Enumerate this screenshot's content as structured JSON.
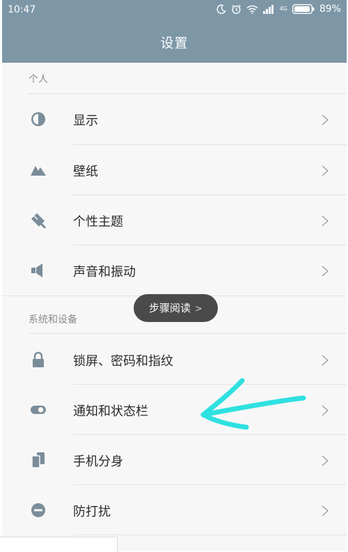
{
  "status_bar": {
    "time": "10:47",
    "battery": "89%",
    "network_small": "4G"
  },
  "header": {
    "title": "设置"
  },
  "sections": [
    {
      "label": "个人",
      "items": [
        {
          "label": "显示",
          "icon": "display-icon"
        },
        {
          "label": "壁纸",
          "icon": "wallpaper-icon"
        },
        {
          "label": "个性主题",
          "icon": "theme-icon"
        },
        {
          "label": "声音和振动",
          "icon": "speaker-icon"
        }
      ]
    },
    {
      "label": "系统和设备",
      "items": [
        {
          "label": "锁屏、密码和指纹",
          "icon": "lock-icon"
        },
        {
          "label": "通知和状态栏",
          "icon": "toggle-icon"
        },
        {
          "label": "手机分身",
          "icon": "dual-phone-icon"
        },
        {
          "label": "防打扰",
          "icon": "do-not-disturb-icon"
        }
      ]
    }
  ],
  "toast": {
    "label": "步骤阅读"
  },
  "colors": {
    "header": "#7d97a7",
    "icon": "#7a8d99",
    "annotation": "#2fe0e0"
  }
}
